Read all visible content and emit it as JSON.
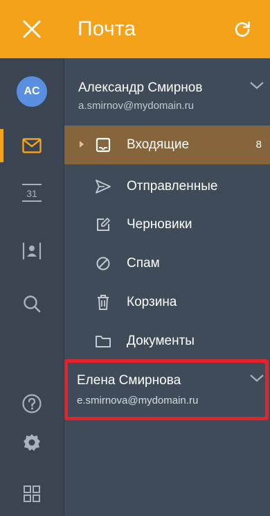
{
  "header": {
    "title": "Почта",
    "close_icon": "close-icon",
    "refresh_icon": "refresh-icon",
    "background": "#f4a21a"
  },
  "rail": {
    "avatar_initials": "AC",
    "avatar_color": "#5a8fe0",
    "calendar_day": "31",
    "items": [
      {
        "name": "mail",
        "icon": "envelope-icon",
        "active": true
      },
      {
        "name": "calendar",
        "icon": "calendar-icon"
      },
      {
        "name": "contacts",
        "icon": "contacts-icon"
      },
      {
        "name": "search",
        "icon": "search-icon"
      },
      {
        "name": "help",
        "icon": "help-icon"
      },
      {
        "name": "settings",
        "icon": "gear-icon"
      },
      {
        "name": "apps",
        "icon": "grid-icon"
      }
    ]
  },
  "accounts": [
    {
      "name": "Александр Смирнов",
      "email": "a.smirnov@mydomain.ru",
      "expanded": true,
      "folders": [
        {
          "label": "Входящие",
          "icon": "inbox-icon",
          "count": "8",
          "selected": true
        },
        {
          "label": "Отправленные",
          "icon": "send-icon"
        },
        {
          "label": "Черновики",
          "icon": "drafts-icon"
        },
        {
          "label": "Спам",
          "icon": "spam-icon"
        },
        {
          "label": "Корзина",
          "icon": "trash-icon"
        },
        {
          "label": "Документы",
          "icon": "folder-icon"
        }
      ]
    },
    {
      "name": "Елена Смирнова",
      "email": "e.smirnova@mydomain.ru",
      "expanded": false,
      "highlighted": true
    }
  ],
  "colors": {
    "accent": "#f4a21a",
    "selected_row": "#86653c",
    "highlight": "#e8202a",
    "panel": "#3f4b58"
  }
}
